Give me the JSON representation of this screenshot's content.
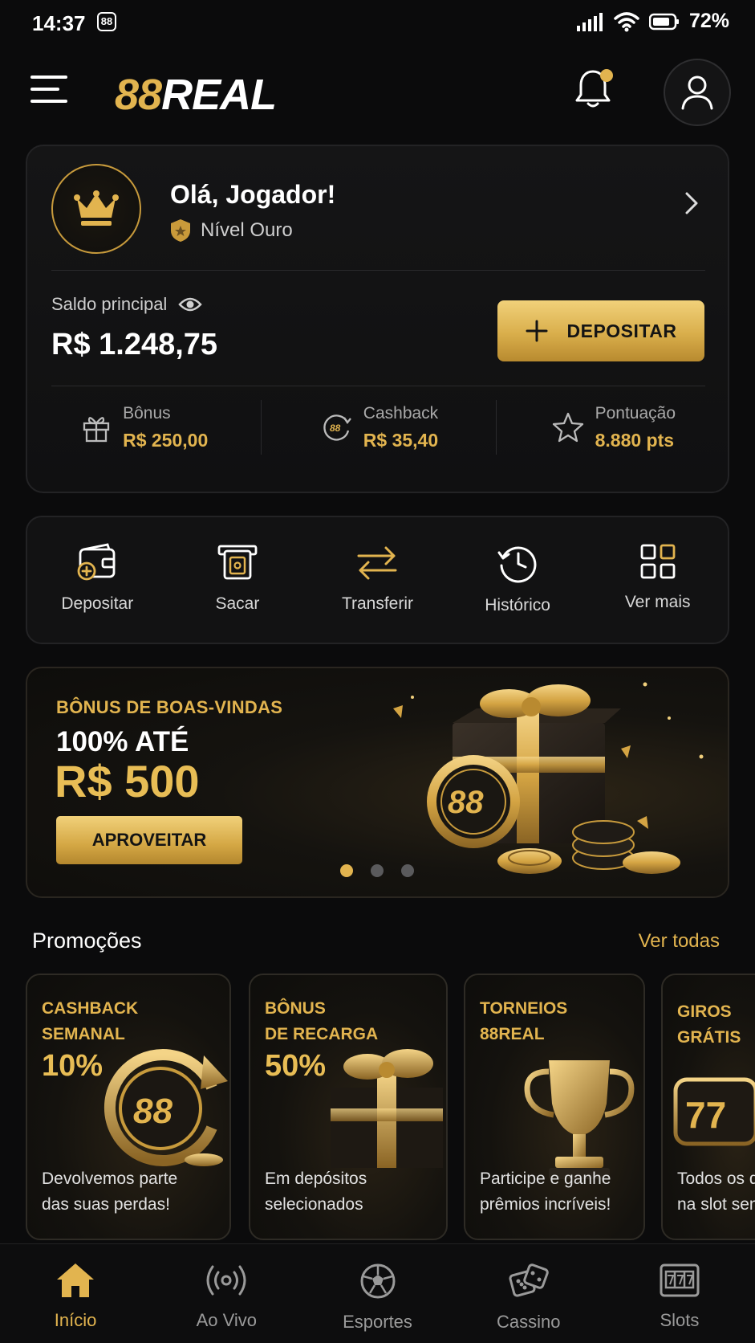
{
  "status_bar": {
    "time": "14:37",
    "app_badge": "88",
    "battery": "72%"
  },
  "header": {
    "logo_accent": "88",
    "logo_text": "REAL"
  },
  "account": {
    "greeting": "Olá, Jogador!",
    "level": "Nível Ouro",
    "balance_label": "Saldo principal",
    "balance_value": "R$ 1.248,75",
    "deposit_label": "DEPOSITAR",
    "stats": [
      {
        "label": "Bônus",
        "value": "R$ 250,00",
        "icon": "gift-icon"
      },
      {
        "label": "Cashback",
        "value": "R$ 35,40",
        "icon": "cashback-icon"
      },
      {
        "label": "Pontuação",
        "value": "8.880 pts",
        "icon": "star-icon"
      }
    ]
  },
  "quick_actions": [
    {
      "label": "Depositar",
      "icon": "wallet-plus-icon"
    },
    {
      "label": "Sacar",
      "icon": "atm-withdraw-icon"
    },
    {
      "label": "Transferir",
      "icon": "transfer-arrows-icon"
    },
    {
      "label": "Histórico",
      "icon": "history-clock-icon"
    },
    {
      "label": "Ver mais",
      "icon": "grid-icon"
    }
  ],
  "banner": {
    "kicker": "BÔNUS DE BOAS-VINDAS",
    "line1": "100% ATÉ",
    "line2": "R$ 500",
    "cta": "APROVEITAR",
    "chip_text": "88",
    "slides": 3,
    "active_slide": 1
  },
  "promotions": {
    "title": "Promoções",
    "see_all": "Ver todas",
    "cards": [
      {
        "line1": "CASHBACK",
        "line2": "SEMANAL",
        "highlight": "10%",
        "desc1": "Devolvemos parte",
        "desc2": "das suas perdas!",
        "art_text": "88"
      },
      {
        "line1": "BÔNUS",
        "line2": "DE RECARGA",
        "highlight": "50%",
        "desc1": "Em depósitos",
        "desc2": "selecionados"
      },
      {
        "line1": "TORNEIOS",
        "line2": "88REAL",
        "highlight": "",
        "desc1": "Participe e ganhe",
        "desc2": "prêmios incríveis!"
      },
      {
        "line1": "GIROS",
        "line2": "GRÁTIS",
        "highlight": "",
        "desc1": "Todos os di",
        "desc2": "na slot sen",
        "art_text": "77"
      }
    ]
  },
  "bottom_nav": [
    {
      "label": "Início",
      "icon": "home-icon",
      "active": true
    },
    {
      "label": "Ao Vivo",
      "icon": "live-broadcast-icon",
      "active": false
    },
    {
      "label": "Esportes",
      "icon": "soccer-ball-icon",
      "active": false
    },
    {
      "label": "Cassino",
      "icon": "dice-icon",
      "active": false
    },
    {
      "label": "Slots",
      "icon": "slot-machine-icon",
      "active": false
    }
  ],
  "colors": {
    "accent": "#e2b44f",
    "background": "#0b0b0c",
    "card": "#121213"
  }
}
